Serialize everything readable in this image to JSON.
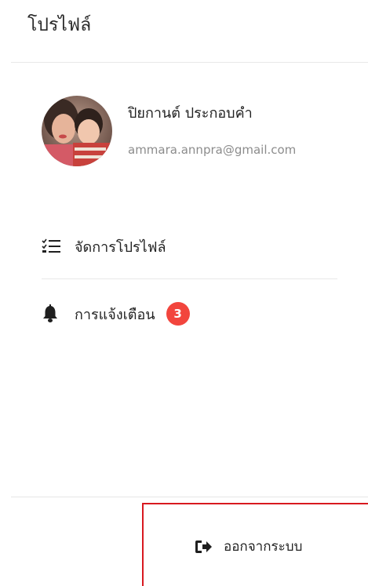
{
  "header": {
    "title": "โปรไฟล์"
  },
  "profile": {
    "name": "ปิยกานต์ ประกอบคำ",
    "email": "ammara.annpra@gmail.com"
  },
  "menu": {
    "manage_profile": {
      "label": "จัดการโปรไฟล์",
      "icon": "checklist-icon"
    },
    "notifications": {
      "label": "การแจ้งเตือน",
      "icon": "bell-icon",
      "badge": "3",
      "badge_color": "#f2453d"
    }
  },
  "logout": {
    "label": "ออกจากระบบ",
    "icon": "sign-out-icon",
    "highlight_color": "#d81920"
  }
}
